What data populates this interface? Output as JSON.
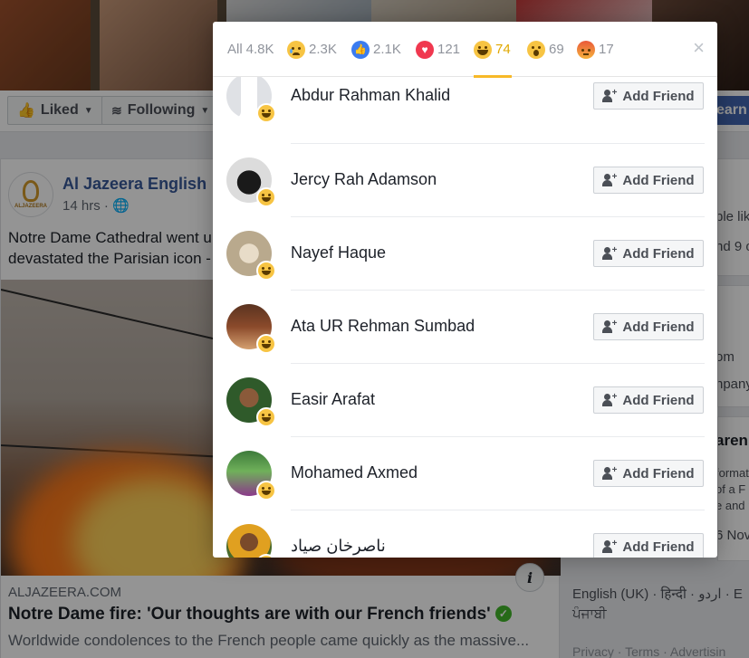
{
  "background": {
    "page_buttons": {
      "liked": "Liked",
      "following": "Following",
      "learn": "earn"
    },
    "post": {
      "page_name": "Al Jazeera English",
      "logo_text": "ALJAZEERA",
      "time": "14 hrs ·",
      "text_line1": "Notre Dame Cathedral went u",
      "text_line2": "devastated the Parisian icon -",
      "source": "ALJAZEERA.COM",
      "headline": "Notre Dame fire: 'Our thoughts are with our French friends'",
      "description": "Worldwide condolences to the French people came quickly as the massive..."
    },
    "sidebar_fragments": [
      "ple like",
      "nd 9 o",
      "om",
      "npany",
      "aren",
      "formati",
      "of a F",
      "e and p",
      "6 Nov"
    ],
    "languages": {
      "line1": "English (UK) · हिन्दी · اردو · E",
      "line2": "ਪੰਜਾਬੀ",
      "footer": "Privacy · Terms · Advertisin"
    }
  },
  "dialog": {
    "tabs": [
      {
        "label": "All",
        "count": "4.8K",
        "reaction": "all"
      },
      {
        "label": "",
        "count": "2.3K",
        "reaction": "sad"
      },
      {
        "label": "",
        "count": "2.1K",
        "reaction": "like"
      },
      {
        "label": "",
        "count": "121",
        "reaction": "love"
      },
      {
        "label": "",
        "count": "74",
        "reaction": "haha",
        "active": true
      },
      {
        "label": "",
        "count": "69",
        "reaction": "wow"
      },
      {
        "label": "",
        "count": "17",
        "reaction": "angry"
      }
    ],
    "close_label": "×",
    "add_friend_label": "Add Friend",
    "people": [
      {
        "name": "Abdur Rahman Khalid"
      },
      {
        "name": "Jercy Rah Adamson"
      },
      {
        "name": "Nayef Haque"
      },
      {
        "name": "Ata UR Rehman Sumbad"
      },
      {
        "name": "Easir Arafat"
      },
      {
        "name": "Mohamed Axmed"
      },
      {
        "name": "ناصرخان صیاد"
      }
    ]
  }
}
